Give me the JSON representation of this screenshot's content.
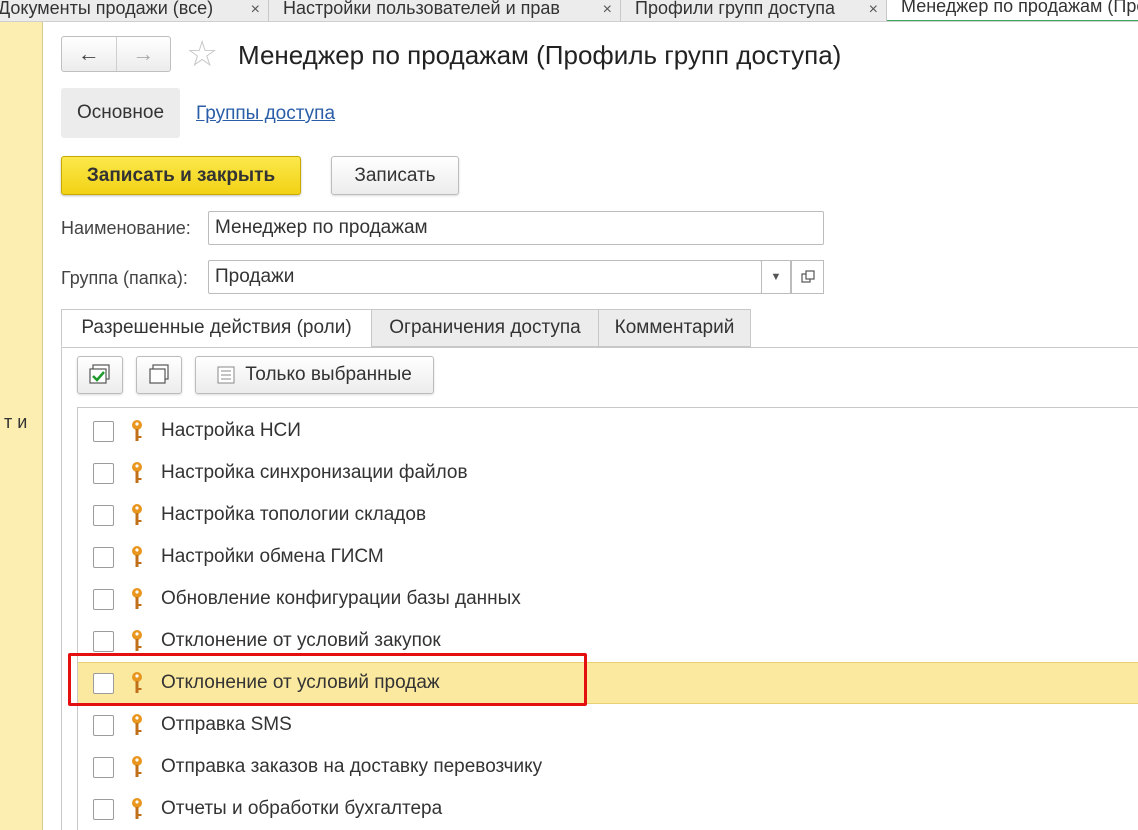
{
  "top_tabs": [
    {
      "label": "Документы продажи (все)",
      "close": "×"
    },
    {
      "label": "Настройки пользователей и прав",
      "close": "×"
    },
    {
      "label": "Профили групп доступа",
      "close": "×"
    },
    {
      "label": "Менеджер по продажам (Профиль групп доступа)",
      "close": ""
    }
  ],
  "left_panel": {
    "text": "т и"
  },
  "nav": {
    "back": "←",
    "forward": "→",
    "favorite": "☆"
  },
  "page_title": "Менеджер по продажам (Профиль групп доступа)",
  "sections": {
    "main": "Основное",
    "link": "Группы доступа"
  },
  "buttons": {
    "save_close": "Записать и закрыть",
    "save": "Записать"
  },
  "fields": {
    "name_label": "Наименование:",
    "name_value": "Менеджер по продажам",
    "group_label": "Группа (папка):",
    "group_value": "Продажи"
  },
  "inner_tabs": [
    "Разрешенные действия (роли)",
    "Ограничения доступа",
    "Комментарий"
  ],
  "toolbar": {
    "only_selected": "Только выбранные"
  },
  "roles": [
    {
      "label": "Настройка НСИ",
      "checked": false
    },
    {
      "label": "Настройка синхронизации файлов",
      "checked": false
    },
    {
      "label": "Настройка топологии складов",
      "checked": false
    },
    {
      "label": "Настройки обмена ГИСМ",
      "checked": false
    },
    {
      "label": "Обновление конфигурации базы данных",
      "checked": false
    },
    {
      "label": "Отклонение от условий закупок",
      "checked": false
    },
    {
      "label": "Отклонение от условий продаж",
      "checked": false,
      "selected": true
    },
    {
      "label": "Отправка SMS",
      "checked": false
    },
    {
      "label": "Отправка заказов на доставку перевозчику",
      "checked": false
    },
    {
      "label": "Отчеты и обработки бухгалтера",
      "checked": false
    }
  ],
  "colors": {
    "accent_yellow": "#f2d215",
    "selected_row": "#fbe9a0",
    "highlight": "#e41010",
    "link": "#2a5ea8",
    "key_orange": "#e8961e"
  }
}
